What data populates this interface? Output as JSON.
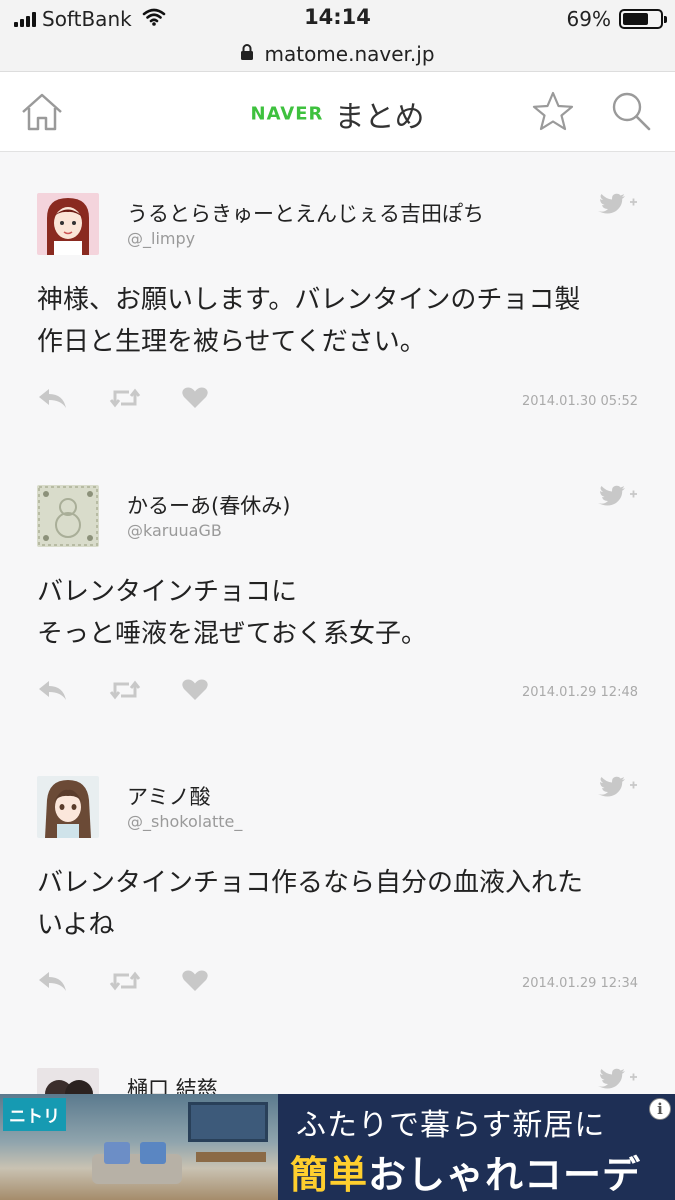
{
  "status_bar": {
    "carrier": "SoftBank",
    "time": "14:14",
    "battery_percent": "69%",
    "battery_level": 0.69
  },
  "browser": {
    "url": "matome.naver.jp"
  },
  "header": {
    "logo_brand": "NAVER",
    "logo_title": "まとめ"
  },
  "tweets": [
    {
      "name": "うるとらきゅーとえんじぇる吉田ぽち",
      "handle": "@_limpy",
      "text": "神様、お願いします。バレンタインのチョコ製\n作日と生理を被らせてください。",
      "date": "2014.01.30 05:52"
    },
    {
      "name": "かるーあ(春休み)",
      "handle": "@karuuaGB",
      "text": "バレンタインチョコに\nそっと唾液を混ぜておく系女子。",
      "date": "2014.01.29 12:48"
    },
    {
      "name": "アミノ酸",
      "handle": "@_shokolatte_",
      "text": "バレンタインチョコ作るなら自分の血液入れた\nいよね",
      "date": "2014.01.29 12:34"
    },
    {
      "name": "樋口 結慈"
    }
  ],
  "ad": {
    "brand": "ニトリ",
    "line1": "ふたりで暮らす新居に",
    "line2_highlight": "簡単",
    "line2_rest": "おしゃれコーデ",
    "info": "i"
  }
}
